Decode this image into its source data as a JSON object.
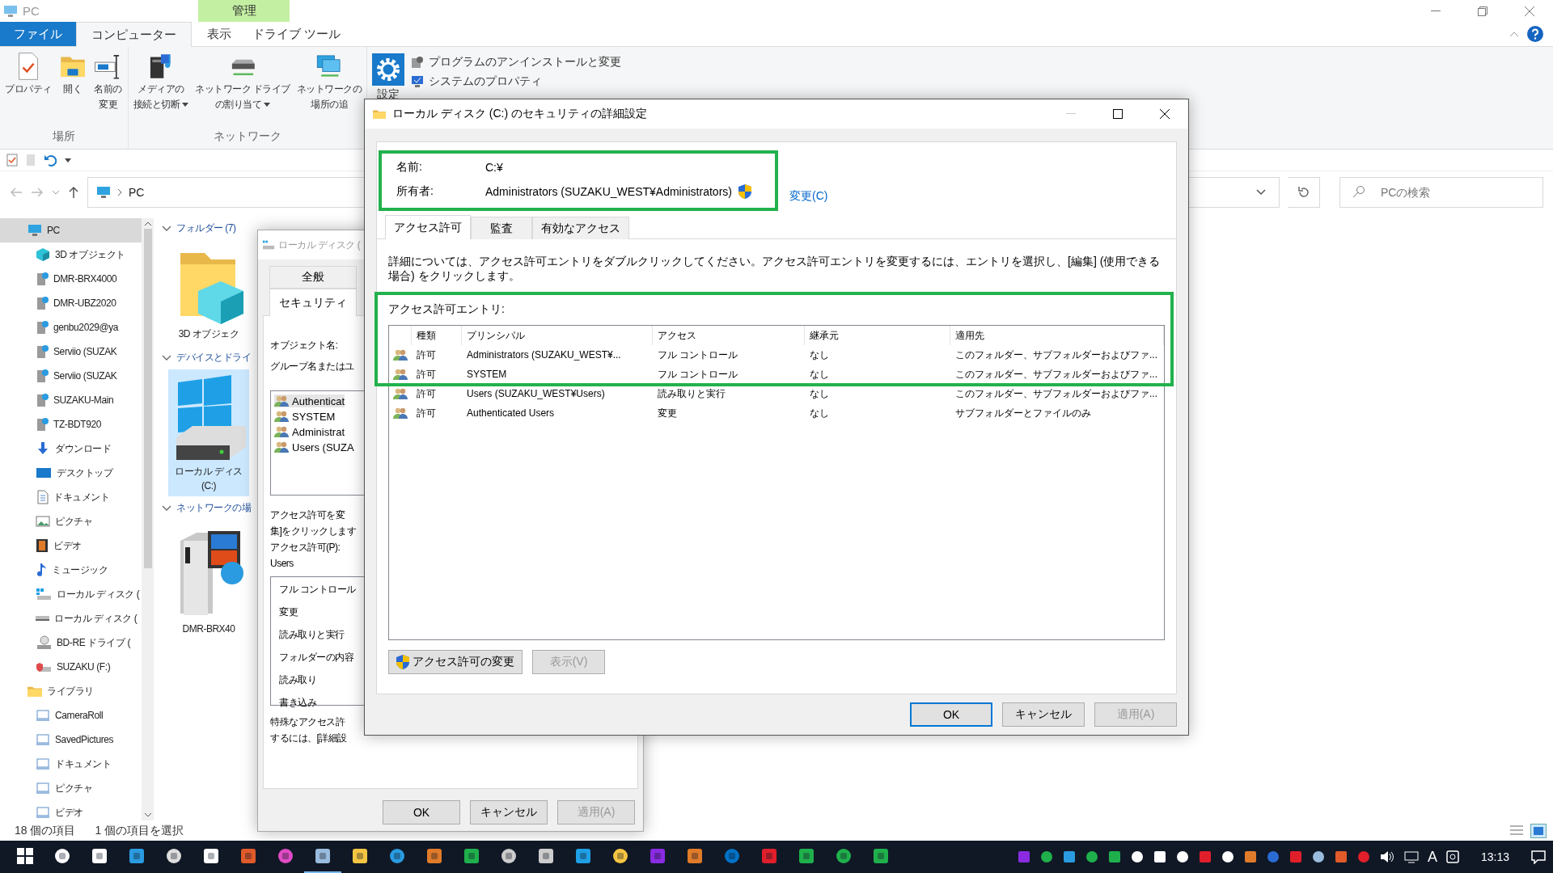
{
  "explorer": {
    "title": "PC",
    "context_header": "管理",
    "ribbon_tabs": [
      {
        "label": "ファイル",
        "kind": "file",
        "selected": false
      },
      {
        "label": "コンピューター",
        "kind": "tab",
        "selected": true
      },
      {
        "label": "表示",
        "kind": "tab",
        "selected": false
      },
      {
        "label": "ドライブ ツール",
        "kind": "context",
        "selected": false
      }
    ],
    "ribbon_groups": [
      {
        "label": "場所",
        "buttons": [
          {
            "label": [
              "プロパティ"
            ],
            "dropdown": false
          },
          {
            "label": [
              "開く"
            ],
            "dropdown": false
          },
          {
            "label": [
              "名前の",
              "変更"
            ],
            "dropdown": false
          }
        ]
      },
      {
        "label": "ネットワーク",
        "buttons": [
          {
            "label": [
              "メディアの",
              "接続と切断"
            ],
            "dropdown": true
          },
          {
            "label": [
              "ネットワーク ドライブ",
              "の割り当て"
            ],
            "dropdown": true
          },
          {
            "label": [
              "ネットワークの",
              "場所の追"
            ],
            "dropdown": false
          }
        ]
      }
    ],
    "system_group": {
      "big_button": "設定",
      "small_buttons": [
        "プログラムのアンインストールと変更",
        "システムのプロパティ"
      ]
    },
    "address": {
      "path": "PC"
    },
    "search": {
      "placeholder": "PCの検索"
    },
    "nav": [
      {
        "label": "PC",
        "selected": true,
        "children": [
          {
            "label": "3D オブジェクト",
            "selected": false
          },
          {
            "label": "DMR-BRX4000",
            "selected": false
          },
          {
            "label": "DMR-UBZ2020",
            "selected": false
          },
          {
            "label": "genbu2029@ya",
            "selected": false
          },
          {
            "label": "Serviio (SUZAK",
            "selected": false
          },
          {
            "label": "Serviio (SUZAK",
            "selected": false
          },
          {
            "label": "SUZAKU-Main",
            "selected": false
          },
          {
            "label": "TZ-BDT920",
            "selected": false
          },
          {
            "label": "ダウンロード",
            "selected": false
          },
          {
            "label": "デスクトップ",
            "selected": false
          },
          {
            "label": "ドキュメント",
            "selected": false
          },
          {
            "label": "ピクチャ",
            "selected": false
          },
          {
            "label": "ビデオ",
            "selected": false
          },
          {
            "label": "ミュージック",
            "selected": false
          },
          {
            "label": "ローカル ディスク (",
            "selected": false
          },
          {
            "label": "ローカル ディスク (",
            "selected": false
          },
          {
            "label": "BD-RE ドライブ (",
            "selected": false
          },
          {
            "label": "SUZAKU (F:)",
            "selected": false
          }
        ]
      },
      {
        "label": "ライブラリ",
        "selected": false,
        "children": [
          {
            "label": "CameraRoll",
            "selected": false
          },
          {
            "label": "SavedPictures",
            "selected": false
          },
          {
            "label": "ドキュメント",
            "selected": false
          },
          {
            "label": "ピクチャ",
            "selected": false
          },
          {
            "label": "ビデオ",
            "selected": false
          }
        ]
      }
    ],
    "content_groups": [
      {
        "header": "フォルダー (7)",
        "items": [
          {
            "label": [
              "3D オブジェク"
            ],
            "selected": false
          }
        ]
      },
      {
        "header": "デバイスとドライ",
        "items": [
          {
            "label": [
              "ローカル ディス",
              "(C:)"
            ],
            "selected": true
          }
        ]
      },
      {
        "header": "ネットワークの場",
        "items": [
          {
            "label": [
              "DMR-BRX40"
            ],
            "selected": false
          }
        ]
      }
    ],
    "status": [
      "18 個の項目",
      "1 個の項目を選択"
    ]
  },
  "properties_dialog": {
    "title": "ローカル ディスク (",
    "tabs": [
      {
        "label": "全般",
        "selected": false
      },
      {
        "label": "セキュリティ",
        "selected": true
      }
    ],
    "object_label": "オブジェクト名:",
    "groups_label": "グループ名またはユ",
    "groups": [
      {
        "name": "Authenticat",
        "selected": true
      },
      {
        "name": "SYSTEM",
        "selected": false
      },
      {
        "name": "Administrat",
        "selected": false
      },
      {
        "name": "Users (SUZA",
        "selected": false
      }
    ],
    "change_note": [
      "アクセス許可を変",
      "集]をクリックします",
      "アクセス許可(P):",
      "Users"
    ],
    "permissions": [
      "フル コントロール",
      "変更",
      "読み取りと実行",
      "フォルダーの内容",
      "読み取り",
      "書き込み"
    ],
    "special_note": [
      "特殊なアクセス許",
      "するには、[詳細設"
    ],
    "buttons": [
      {
        "label": "OK",
        "disabled": false
      },
      {
        "label": "キャンセル",
        "disabled": false
      },
      {
        "label": "適用(A)",
        "disabled": true
      }
    ]
  },
  "advanced_dialog": {
    "title": "ローカル ディスク (C:) のセキュリティの詳細設定",
    "name_label": "名前:",
    "name_value": "C:¥",
    "owner_label": "所有者:",
    "owner_value": "Administrators (SUZAKU_WEST¥Administrators)",
    "owner_change": "変更(C)",
    "tabs": [
      {
        "label": "アクセス許可",
        "selected": true
      },
      {
        "label": "監査",
        "selected": false
      },
      {
        "label": "有効なアクセス",
        "selected": false
      }
    ],
    "description": "詳細については、アクセス許可エントリをダブルクリックしてください。アクセス許可エントリを変更するには、エントリを選択し、[編集] (使用できる場合) をクリックします。",
    "entries_label": "アクセス許可エントリ:",
    "columns": [
      "種類",
      "プリンシパル",
      "アクセス",
      "継承元",
      "適用先"
    ],
    "rows": [
      [
        "許可",
        "Administrators (SUZAKU_WEST¥...",
        "フル コントロール",
        "なし",
        "このフォルダー、サブフォルダーおよびファ..."
      ],
      [
        "許可",
        "SYSTEM",
        "フル コントロール",
        "なし",
        "このフォルダー、サブフォルダーおよびファ..."
      ],
      [
        "許可",
        "Users (SUZAKU_WEST¥Users)",
        "読み取りと実行",
        "なし",
        "このフォルダー、サブフォルダーおよびファ..."
      ],
      [
        "許可",
        "Authenticated Users",
        "変更",
        "なし",
        "サブフォルダーとファイルのみ"
      ]
    ],
    "actions": [
      {
        "label": "アクセス許可の変更",
        "disabled": false,
        "shield": true
      },
      {
        "label": "表示(V)",
        "disabled": true,
        "shield": false
      }
    ],
    "buttons": [
      {
        "label": "OK",
        "disabled": false,
        "default": true
      },
      {
        "label": "キャンセル",
        "disabled": false,
        "default": false
      },
      {
        "label": "適用(A)",
        "disabled": true,
        "default": false
      }
    ]
  },
  "taskbar": {
    "ime": "A",
    "clock": "13:13"
  }
}
